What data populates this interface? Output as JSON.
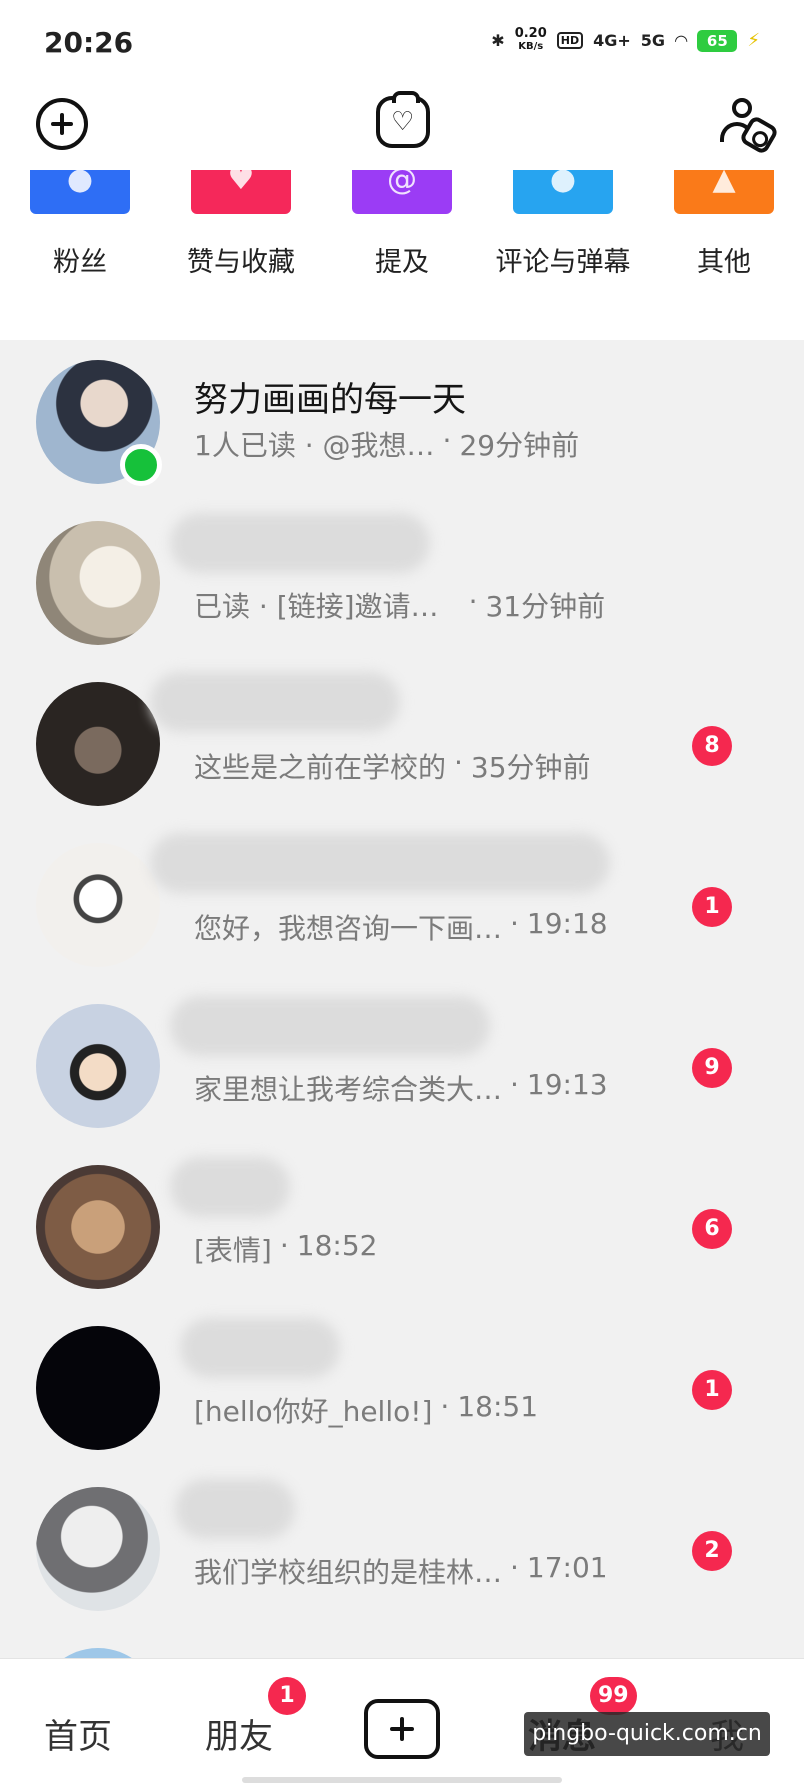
{
  "status_bar": {
    "time": "20:26",
    "net_speed_value": "0.20",
    "net_speed_unit": "KB/s",
    "hd_label": "HD",
    "signal_4g": "4G+",
    "signal_5g": "5G",
    "battery_level": "65"
  },
  "categories": [
    {
      "label": "粉丝",
      "icon": "people-icon",
      "color": "#2e6ef5"
    },
    {
      "label": "赞与收藏",
      "icon": "heart-icon",
      "color": "#f5285a"
    },
    {
      "label": "提及",
      "icon": "at-icon",
      "color": "#9b3cf5"
    },
    {
      "label": "评论与弹幕",
      "icon": "comment-icon",
      "color": "#27a4f0"
    },
    {
      "label": "其他",
      "icon": "bell-icon",
      "color": "#fa7a19"
    }
  ],
  "conversations": [
    {
      "name": "努力画画的每一天",
      "meta_left": "1人已读 · @我想…",
      "time": "29分钟前",
      "badge": "",
      "online": true,
      "avatar_color": "#5b6a7e"
    },
    {
      "name": "",
      "meta_left": "已读 · [链接]邀请…",
      "time": "31分钟前",
      "badge": "",
      "online": false,
      "avatar_color": "#cfc7b6"
    },
    {
      "name": "",
      "meta_left": "这些是之前在学校的",
      "time": "35分钟前",
      "badge": "8",
      "online": false,
      "avatar_color": "#2f2a26"
    },
    {
      "name": "",
      "meta_left": "您好，我想咨询一下画…",
      "time": "19:18",
      "badge": "1",
      "online": false,
      "avatar_color": "#e8e4e0"
    },
    {
      "name": "",
      "meta_left": "家里想让我考综合类大…",
      "time": "19:13",
      "badge": "9",
      "online": false,
      "avatar_color": "#b8c6d8"
    },
    {
      "name": "",
      "meta_left": "[表情]",
      "time": "18:52",
      "badge": "6",
      "online": false,
      "avatar_color": "#a07a58"
    },
    {
      "name": "",
      "meta_left": "[hello你好_hello!]",
      "time": "18:51",
      "badge": "1",
      "online": false,
      "avatar_color": "#05050a"
    },
    {
      "name": "",
      "meta_left": "我们学校组织的是桂林…",
      "time": "17:01",
      "badge": "2",
      "online": false,
      "avatar_color": "#d9dcdf"
    }
  ],
  "bottom_nav": {
    "home": "首页",
    "friends": "朋友",
    "friends_badge": "1",
    "messages": "消息",
    "messages_badge": "99",
    "me": "我"
  },
  "watermark": "pingbo-quick.com.cn"
}
